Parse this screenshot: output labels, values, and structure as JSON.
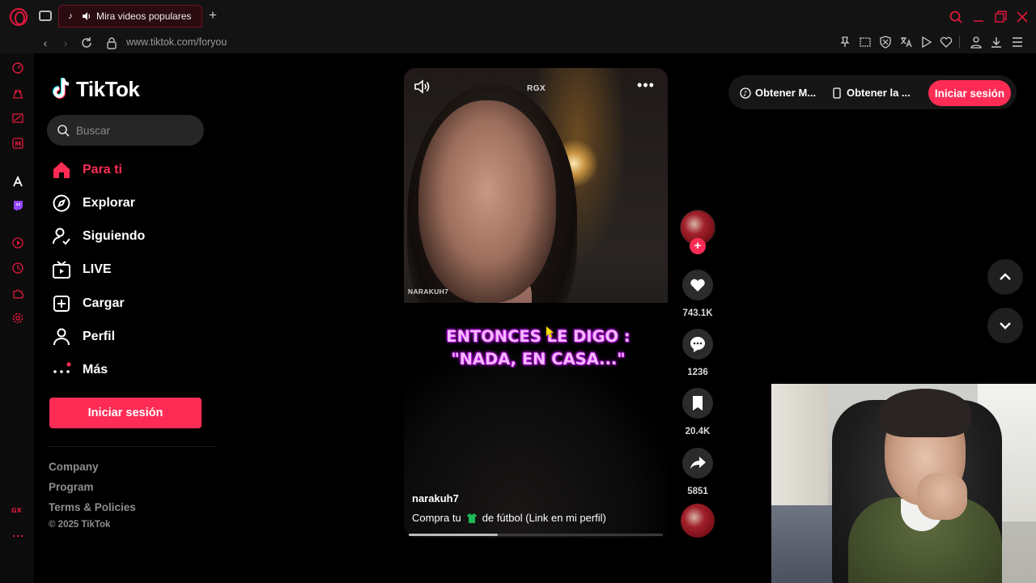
{
  "browser": {
    "tab_title": "Mira videos populares",
    "new_tab_symbol": "+",
    "url": "www.tiktok.com/foryou"
  },
  "tiktok": {
    "logo_text": "TikTok",
    "search_placeholder": "Buscar",
    "nav": [
      {
        "label": "Para ti",
        "icon": "home-icon",
        "active": true
      },
      {
        "label": "Explorar",
        "icon": "compass-icon"
      },
      {
        "label": "Siguiendo",
        "icon": "following-icon"
      },
      {
        "label": "LIVE",
        "icon": "live-tv-icon"
      },
      {
        "label": "Cargar",
        "icon": "upload-icon"
      },
      {
        "label": "Perfil",
        "icon": "profile-icon"
      },
      {
        "label": "Más",
        "icon": "more-dots-icon"
      }
    ],
    "login_label": "Iniciar sesión",
    "footer": {
      "company": "Company",
      "program": "Program",
      "terms": "Terms & Policies",
      "copyright": "© 2025 TikTok"
    },
    "top_actions": {
      "get_coins": "Obtener M...",
      "get_app": "Obtener la ...",
      "login": "Iniciar sesión"
    }
  },
  "video": {
    "badge": "RGX",
    "watermark": "NARAKUH7",
    "caption_line1": "ENTONCES LE DIGO :",
    "caption_line2": "\"NADA, EN CASA...\"",
    "username": "narakuh7",
    "description_before": "Compra tu",
    "description_after": "de fútbol (Link en mi perfil)",
    "progress": 0.35,
    "likes": "743.1K",
    "comments": "1236",
    "saves": "20.4K",
    "shares": "5851"
  },
  "colors": {
    "accent": "#fe2c55",
    "opera_red": "#e2183c",
    "caption_purple": "#f4b9ff"
  }
}
